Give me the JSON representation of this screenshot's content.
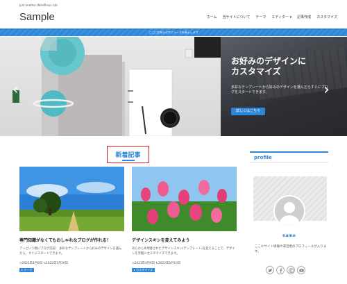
{
  "site": {
    "tagline": "Just another WordPress site",
    "title": "Sample"
  },
  "nav": [
    "ホーム",
    "当サイトについて",
    "テーマ",
    "エディター",
    "記事作成",
    "カスタマイズ"
  ],
  "notice": "ここにお知らせやニュースを表示します",
  "hero": {
    "title_line1": "お好みのデザインに",
    "title_line2": "カスタマイズ",
    "text": "多彩なテンプレートから好みのデザインを選んだらすぐにブログをスタートできます。",
    "button": "詳しくはこちら"
  },
  "section_heading": "新着記事",
  "posts": [
    {
      "title": "専門知識がなくてもおしゃれなブログが作れる！",
      "excerpt": "アッという間にブログ完成！ 多彩なテンプレートから好みのデザインを選んだら、すぐにスタートできます。",
      "published": "2021年4月6日",
      "updated": "2022年1月26日",
      "tag": "テーマ"
    },
    {
      "title": "デザインスキンを変えてみよう",
      "excerpt": "あらかじめ用意されたデザインスキン(テンプレート)を変えることで、デザインを手軽にカスタマイズできます。",
      "published": "2021年4月6日",
      "updated": "2022年6月10日",
      "tag": "カスタマイズ"
    }
  ],
  "sidebar": {
    "title": "profile",
    "name": "name",
    "text": "ここにサイト情報や運営者のプロフィールが入ります。",
    "social": [
      "twitter-icon",
      "facebook-icon",
      "instagram-icon",
      "youtube-icon"
    ]
  },
  "colors": {
    "accent": "#2f86d6",
    "highlight": "#e02020"
  }
}
